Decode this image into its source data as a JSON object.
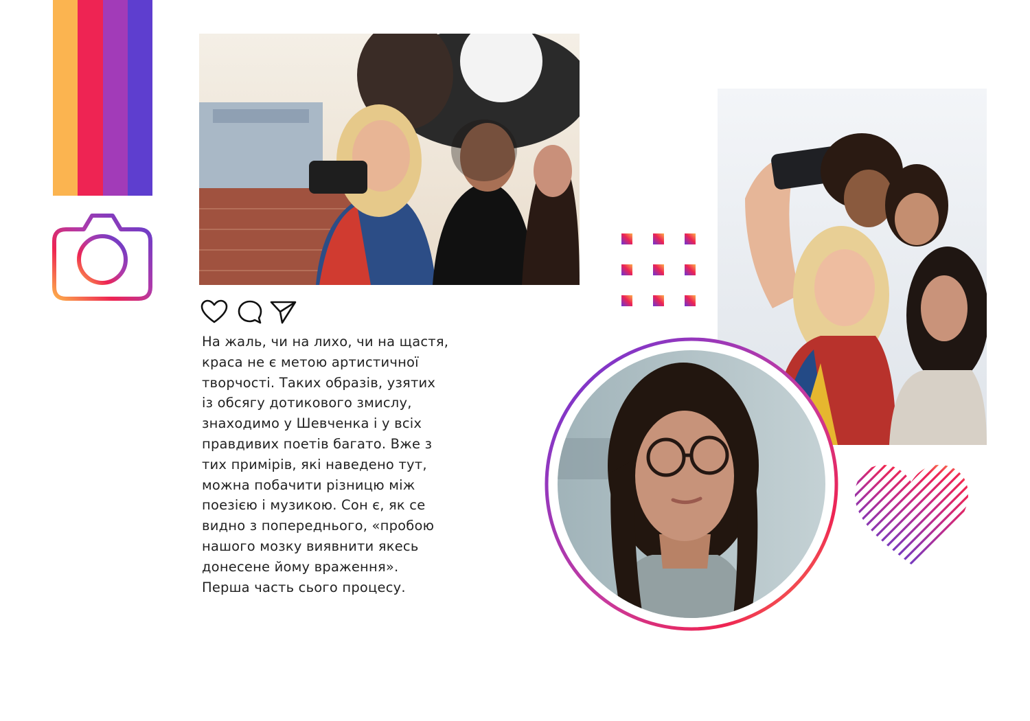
{
  "brand_colors": {
    "stripes": [
      "#FBB450",
      "#EE2453",
      "#A23BB8",
      "#5E3ECF"
    ],
    "gradient_start": "#FDB04A",
    "gradient_mid": "#EE2453",
    "gradient_end": "#6A35D6"
  },
  "decor": {
    "logo_icon": "camera-icon",
    "actions": [
      "heart-icon",
      "comment-icon",
      "send-icon"
    ],
    "dots_icon": "dot-grid",
    "heart_icon": "scribble-heart-icon"
  },
  "photos": {
    "main": "group-selfie-rooftop",
    "right": "friends-selfie-sky",
    "circle": "woman-with-glasses-portrait"
  },
  "caption": "На жаль, чи на лихо, чи на щастя,\nкраса не є метою артистичної\nтворчості. Таких образів, узятих\nіз обсягу дотикового змислу,\nзнаходимо у Шевченка і у всіх\nправдивих поетів багато. Вже з\nтих примірів, які наведено тут,\nможна побачити різницю між\nпоезією і музикою. Сон є, як се\nвидно з попереднього, «пробою\nнашого мозку виявнити якесь\nдонесене йому враження».\nПерша часть сього процесу."
}
